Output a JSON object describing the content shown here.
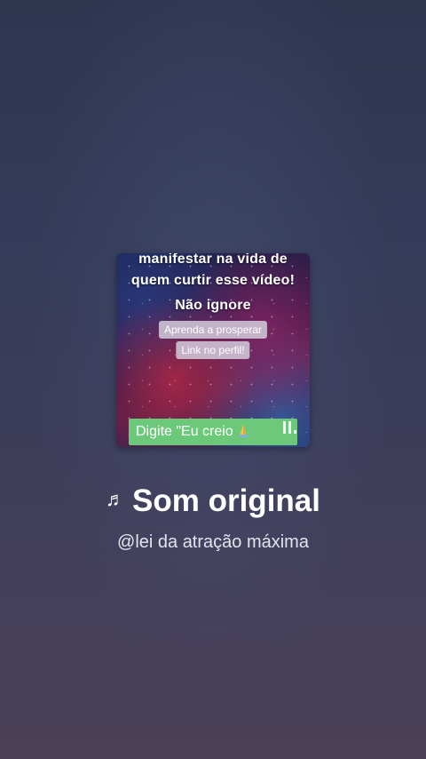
{
  "thumbnail": {
    "line1": "manifestar na vida de",
    "line2": "quem curtir esse vídeo!",
    "line3": "Não ignore",
    "pill1": "Aprenda a prosperar",
    "pill2": "Link no perfil!",
    "cta": "Digite \"Eu creio ",
    "cta_icon": "praying-hands-icon",
    "playback_icon": "pause-icon"
  },
  "sound": {
    "title": "Som original",
    "icon": "music-note-icon",
    "author": "@lei da atração máxima"
  },
  "colors": {
    "background_top": "#2e3650",
    "background_bottom": "#4a4058",
    "cta_green": "#6cc97a"
  }
}
